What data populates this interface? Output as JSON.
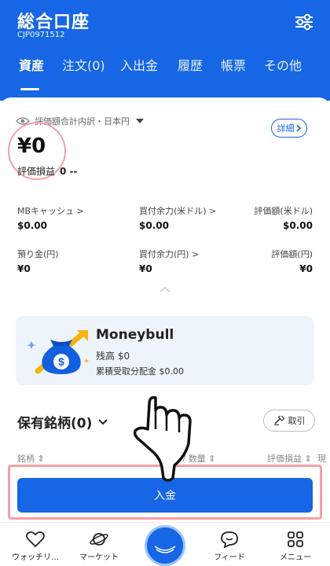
{
  "header": {
    "title": "総合口座",
    "account_id": "CJP0971512",
    "filter_icon": "filter-sliders-icon"
  },
  "tabs": [
    {
      "label": "資産",
      "active": true
    },
    {
      "label": "注文(0)"
    },
    {
      "label": "入出金"
    },
    {
      "label": "履歴"
    },
    {
      "label": "帳票"
    },
    {
      "label": "その他"
    }
  ],
  "summary": {
    "eval_label": "評価額合計内訳・日本円",
    "detail_label": "詳細",
    "total_value": "¥0",
    "pl_label": "評価損益",
    "pl_value": "0 --"
  },
  "grid": [
    {
      "label": "MBキャッシュ >",
      "value": "$0.00"
    },
    {
      "label": "買付余力(米ドル) >",
      "value": "$0.00"
    },
    {
      "label": "評価額(米ドル)",
      "value": "$0.00"
    },
    {
      "label": "預り金(円)",
      "value": "¥0"
    },
    {
      "label": "買付余力(円) >",
      "value": "¥0"
    },
    {
      "label": "評価額(円)",
      "value": "¥0"
    }
  ],
  "moneybull": {
    "title": "Moneybull",
    "balance": "残高 $0",
    "cumulative": "累積受取分配金 $0.00",
    "colors": {
      "bag": "#1260e0",
      "arrow": "#f5b40f"
    }
  },
  "holdings": {
    "title": "保有銘柄(0)",
    "trade_label": "取引",
    "columns": [
      "銘柄 ⇕",
      "額 / 数量 ⇕",
      "評価損益 ⇕",
      "現"
    ]
  },
  "deposit_label": "入金",
  "bottom_nav": [
    {
      "label": "ウォッチリ…",
      "icon": "heart-icon"
    },
    {
      "label": "マーケット",
      "icon": "planet-icon"
    },
    {
      "label": "",
      "icon": "center-orb-icon"
    },
    {
      "label": "フィード",
      "icon": "chat-bubble-icon"
    },
    {
      "label": "メニュー",
      "icon": "menu-grid-icon"
    }
  ],
  "colors": {
    "primary": "#1666e5",
    "highlight": "#f3a0a4",
    "card_bg": "#eef4fc"
  }
}
